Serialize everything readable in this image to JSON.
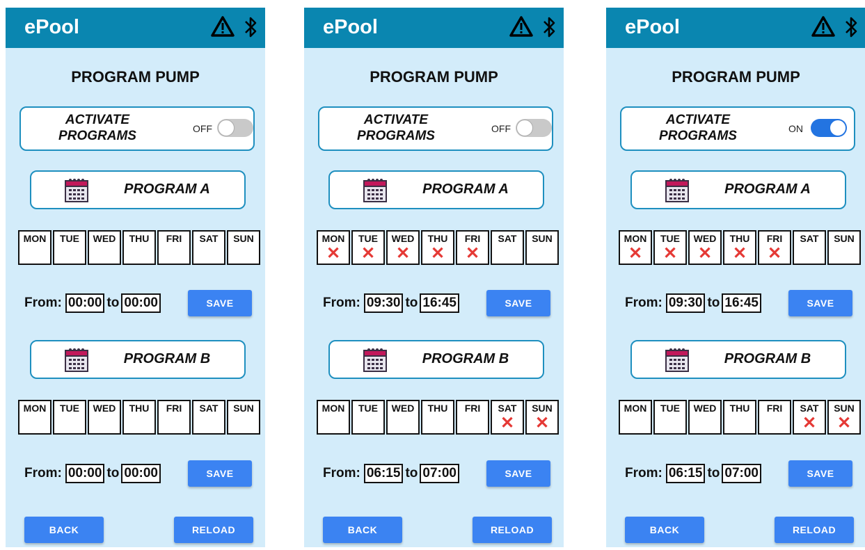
{
  "colors": {
    "header": "#0a86b0",
    "background": "#d3ecfa",
    "accent": "#3b83f2",
    "mark": "#e53935"
  },
  "screens": [
    {
      "app_title": "ePool",
      "page_title": "PROGRAM PUMP",
      "activate_label": "ACTIVATE PROGRAMS",
      "toggle": {
        "state_label": "OFF",
        "on": false
      },
      "programs": [
        {
          "label": "PROGRAM A",
          "days": [
            {
              "label": "MON",
              "mark": ""
            },
            {
              "label": "TUE",
              "mark": ""
            },
            {
              "label": "WED",
              "mark": ""
            },
            {
              "label": "THU",
              "mark": ""
            },
            {
              "label": "FRI",
              "mark": ""
            },
            {
              "label": "SAT",
              "mark": ""
            },
            {
              "label": "SUN",
              "mark": ""
            }
          ],
          "from_label": "From:",
          "from_time": "00:00",
          "to_label": "to",
          "to_time": "00:00",
          "save_label": "SAVE"
        },
        {
          "label": "PROGRAM B",
          "days": [
            {
              "label": "MON",
              "mark": ""
            },
            {
              "label": "TUE",
              "mark": ""
            },
            {
              "label": "WED",
              "mark": ""
            },
            {
              "label": "THU",
              "mark": ""
            },
            {
              "label": "FRI",
              "mark": ""
            },
            {
              "label": "SAT",
              "mark": ""
            },
            {
              "label": "SUN",
              "mark": ""
            }
          ],
          "from_label": "From:",
          "from_time": "00:00",
          "to_label": "to",
          "to_time": "00:00",
          "save_label": "SAVE"
        }
      ],
      "back_label": "BACK",
      "reload_label": "RELOAD"
    },
    {
      "app_title": "ePool",
      "page_title": "PROGRAM PUMP",
      "activate_label": "ACTIVATE PROGRAMS",
      "toggle": {
        "state_label": "OFF",
        "on": false
      },
      "programs": [
        {
          "label": "PROGRAM A",
          "days": [
            {
              "label": "MON",
              "mark": "✕"
            },
            {
              "label": "TUE",
              "mark": "✕"
            },
            {
              "label": "WED",
              "mark": "✕"
            },
            {
              "label": "THU",
              "mark": "✕"
            },
            {
              "label": "FRI",
              "mark": "✕"
            },
            {
              "label": "SAT",
              "mark": ""
            },
            {
              "label": "SUN",
              "mark": ""
            }
          ],
          "from_label": "From:",
          "from_time": "09:30",
          "to_label": "to",
          "to_time": "16:45",
          "save_label": "SAVE"
        },
        {
          "label": "PROGRAM B",
          "days": [
            {
              "label": "MON",
              "mark": ""
            },
            {
              "label": "TUE",
              "mark": ""
            },
            {
              "label": "WED",
              "mark": ""
            },
            {
              "label": "THU",
              "mark": ""
            },
            {
              "label": "FRI",
              "mark": ""
            },
            {
              "label": "SAT",
              "mark": "✕"
            },
            {
              "label": "SUN",
              "mark": "✕"
            }
          ],
          "from_label": "From:",
          "from_time": "06:15",
          "to_label": "to",
          "to_time": "07:00",
          "save_label": "SAVE"
        }
      ],
      "back_label": "BACK",
      "reload_label": "RELOAD"
    },
    {
      "app_title": "ePool",
      "page_title": "PROGRAM PUMP",
      "activate_label": "ACTIVATE PROGRAMS",
      "toggle": {
        "state_label": "ON",
        "on": true
      },
      "programs": [
        {
          "label": "PROGRAM A",
          "days": [
            {
              "label": "MON",
              "mark": "✕"
            },
            {
              "label": "TUE",
              "mark": "✕"
            },
            {
              "label": "WED",
              "mark": "✕"
            },
            {
              "label": "THU",
              "mark": "✕"
            },
            {
              "label": "FRI",
              "mark": "✕"
            },
            {
              "label": "SAT",
              "mark": ""
            },
            {
              "label": "SUN",
              "mark": ""
            }
          ],
          "from_label": "From:",
          "from_time": "09:30",
          "to_label": "to",
          "to_time": "16:45",
          "save_label": "SAVE"
        },
        {
          "label": "PROGRAM B",
          "days": [
            {
              "label": "MON",
              "mark": ""
            },
            {
              "label": "TUE",
              "mark": ""
            },
            {
              "label": "WED",
              "mark": ""
            },
            {
              "label": "THU",
              "mark": ""
            },
            {
              "label": "FRI",
              "mark": ""
            },
            {
              "label": "SAT",
              "mark": "✕"
            },
            {
              "label": "SUN",
              "mark": "✕"
            }
          ],
          "from_label": "From:",
          "from_time": "06:15",
          "to_label": "to",
          "to_time": "07:00",
          "save_label": "SAVE"
        }
      ],
      "back_label": "BACK",
      "reload_label": "RELOAD"
    }
  ]
}
